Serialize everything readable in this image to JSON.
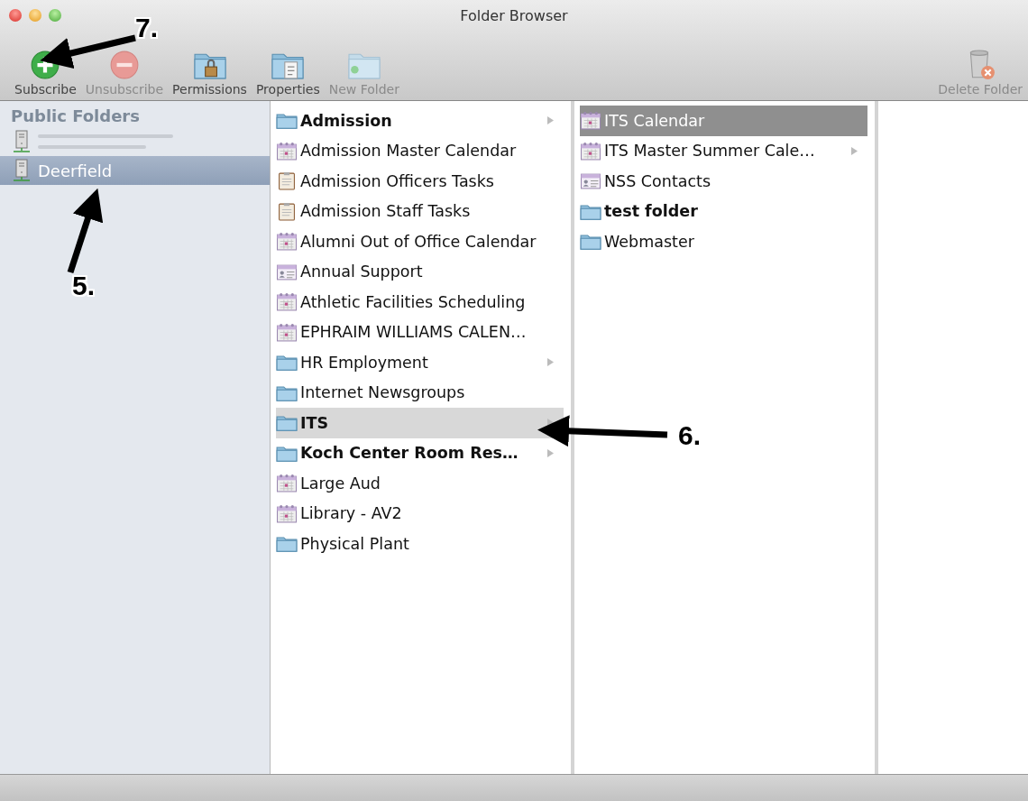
{
  "window": {
    "title": "Folder Browser"
  },
  "toolbar": {
    "buttons": [
      {
        "kind": "subscribe",
        "label": "Subscribe",
        "disabled": false
      },
      {
        "kind": "unsubscribe",
        "label": "Unsubscribe",
        "disabled": true
      },
      {
        "kind": "permissions",
        "label": "Permissions",
        "disabled": false
      },
      {
        "kind": "properties",
        "label": "Properties",
        "disabled": false
      },
      {
        "kind": "new-folder",
        "label": "New Folder",
        "disabled": true
      }
    ],
    "right_buttons": [
      {
        "kind": "delete",
        "label": "Delete Folder",
        "disabled": true
      }
    ]
  },
  "sidebar": {
    "header": "Public Folders",
    "items": [
      {
        "kind": "redacted",
        "selected": false
      },
      {
        "kind": "server",
        "label": "Deerfield",
        "selected": true
      }
    ]
  },
  "columns": [
    {
      "focused": false,
      "items": [
        {
          "kind": "folder",
          "label": "Admission",
          "bold": true,
          "has_children": true,
          "selected": false
        },
        {
          "kind": "calendar",
          "label": "Admission Master Calendar",
          "bold": false,
          "has_children": false,
          "selected": false
        },
        {
          "kind": "tasks",
          "label": "Admission Officers Tasks",
          "bold": false,
          "has_children": false,
          "selected": false
        },
        {
          "kind": "tasks",
          "label": "Admission Staff Tasks",
          "bold": false,
          "has_children": false,
          "selected": false
        },
        {
          "kind": "calendar",
          "label": "Alumni Out of Office Calendar",
          "bold": false,
          "has_children": false,
          "selected": false
        },
        {
          "kind": "contacts",
          "label": "Annual Support",
          "bold": false,
          "has_children": false,
          "selected": false
        },
        {
          "kind": "calendar",
          "label": "Athletic Facilities Scheduling",
          "bold": false,
          "has_children": false,
          "selected": false
        },
        {
          "kind": "calendar",
          "label": "EPHRAIM WILLIAMS CALEN…",
          "bold": false,
          "has_children": false,
          "selected": false
        },
        {
          "kind": "folder",
          "label": "HR Employment",
          "bold": false,
          "has_children": true,
          "selected": false
        },
        {
          "kind": "folder",
          "label": "Internet Newsgroups",
          "bold": false,
          "has_children": false,
          "selected": false
        },
        {
          "kind": "folder",
          "label": "ITS",
          "bold": true,
          "has_children": true,
          "selected": true
        },
        {
          "kind": "folder",
          "label": "Koch Center Room Res…",
          "bold": true,
          "has_children": true,
          "selected": false
        },
        {
          "kind": "calendar",
          "label": "Large Aud",
          "bold": false,
          "has_children": false,
          "selected": false
        },
        {
          "kind": "calendar",
          "label": "Library - AV2",
          "bold": false,
          "has_children": false,
          "selected": false
        },
        {
          "kind": "folder",
          "label": "Physical Plant",
          "bold": false,
          "has_children": false,
          "selected": false
        }
      ]
    },
    {
      "focused": true,
      "items": [
        {
          "kind": "calendar",
          "label": "ITS Calendar",
          "bold": false,
          "has_children": false,
          "selected": true
        },
        {
          "kind": "calendar",
          "label": "ITS Master Summer Cale…",
          "bold": false,
          "has_children": true,
          "selected": false
        },
        {
          "kind": "contacts",
          "label": "NSS Contacts",
          "bold": false,
          "has_children": false,
          "selected": false
        },
        {
          "kind": "folder",
          "label": "test folder",
          "bold": true,
          "has_children": false,
          "selected": false
        },
        {
          "kind": "folder",
          "label": "Webmaster",
          "bold": false,
          "has_children": false,
          "selected": false
        }
      ]
    }
  ],
  "annotations": [
    {
      "label": "7."
    },
    {
      "label": "5."
    },
    {
      "label": "6."
    }
  ]
}
